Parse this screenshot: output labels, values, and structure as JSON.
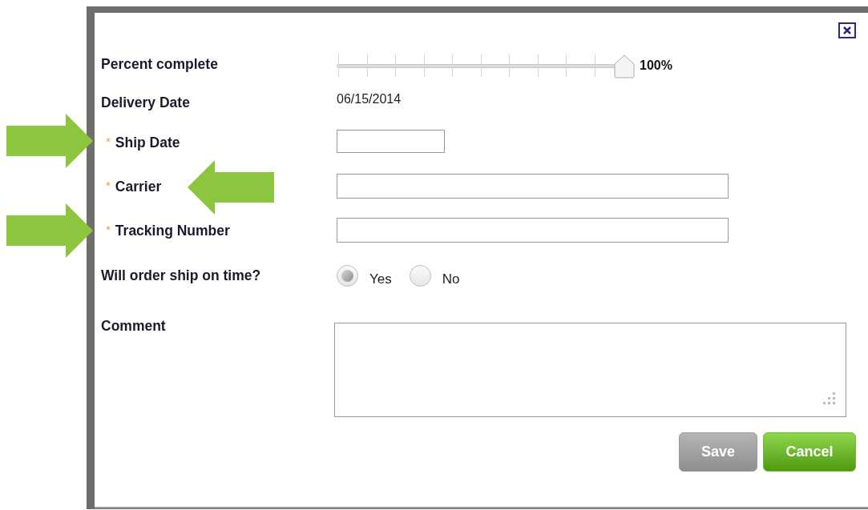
{
  "dialog": {
    "fields": [
      {
        "kind": "slider",
        "label": "Percent complete",
        "level": 1,
        "reading": "100%"
      },
      {
        "kind": "value",
        "label": "Delivery Date",
        "value": "06/15/2014"
      },
      {
        "kind": "short-input",
        "label": "Ship Date",
        "required_mark": "*"
      },
      {
        "kind": "input",
        "label": "Carrier",
        "required_mark": "*"
      },
      {
        "kind": "input",
        "label": "Tracking Number",
        "required_mark": "*"
      },
      {
        "kind": "radio",
        "label": "Will order ship on time?",
        "options": [
          {
            "label": "Yes",
            "selected": true
          },
          {
            "label": "No",
            "selected": false
          }
        ]
      },
      {
        "kind": "textarea",
        "label": "Comment"
      }
    ],
    "buttons": [
      {
        "label": "Save",
        "kind": "secondary"
      },
      {
        "label": "Cancel",
        "kind": "primary"
      }
    ]
  }
}
